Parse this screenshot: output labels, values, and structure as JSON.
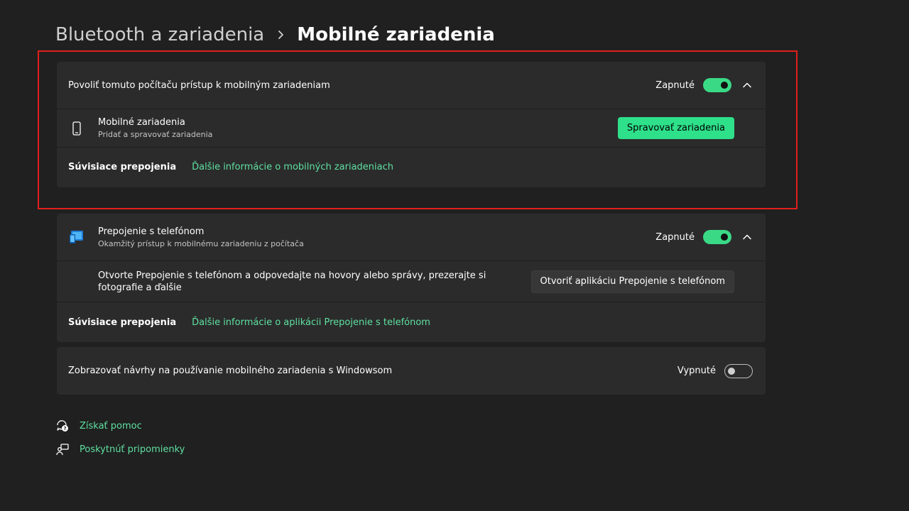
{
  "breadcrumb": {
    "parent": "Bluetooth a zariadenia",
    "current": "Mobilné zariadenia"
  },
  "mobile_access": {
    "label": "Povoliť tomuto počítaču prístup k mobilným zariadeniam",
    "state": "Zapnuté",
    "devices": {
      "title": "Mobilné zariadenia",
      "subtitle": "Pridať a spravovať zariadenia",
      "button": "Spravovať zariadenia"
    },
    "related": {
      "label": "Súvisiace prepojenia",
      "link": "Ďalšie informácie o mobilných zariadeniach"
    }
  },
  "phone_link": {
    "title": "Prepojenie s telefónom",
    "subtitle": "Okamžitý prístup k mobilnému zariadeniu z počítača",
    "state": "Zapnuté",
    "description": "Otvorte Prepojenie s telefónom a odpovedajte na hovory alebo správy, prezerajte si fotografie a ďalšie",
    "button": "Otvoriť aplikáciu Prepojenie s telefónom",
    "related": {
      "label": "Súvisiace prepojenia",
      "link": "Ďalšie informácie o aplikácii Prepojenie s telefónom"
    }
  },
  "suggestions": {
    "label": "Zobrazovať návrhy na používanie mobilného zariadenia s Windowsom",
    "state": "Vypnuté"
  },
  "footer": {
    "help": "Získať pomoc",
    "feedback": "Poskytnúť pripomienky"
  },
  "colors": {
    "accent": "#2ee08a",
    "link": "#5ee0a0",
    "background": "#202020",
    "card": "#2b2b2b",
    "highlight": "#e0201b"
  }
}
